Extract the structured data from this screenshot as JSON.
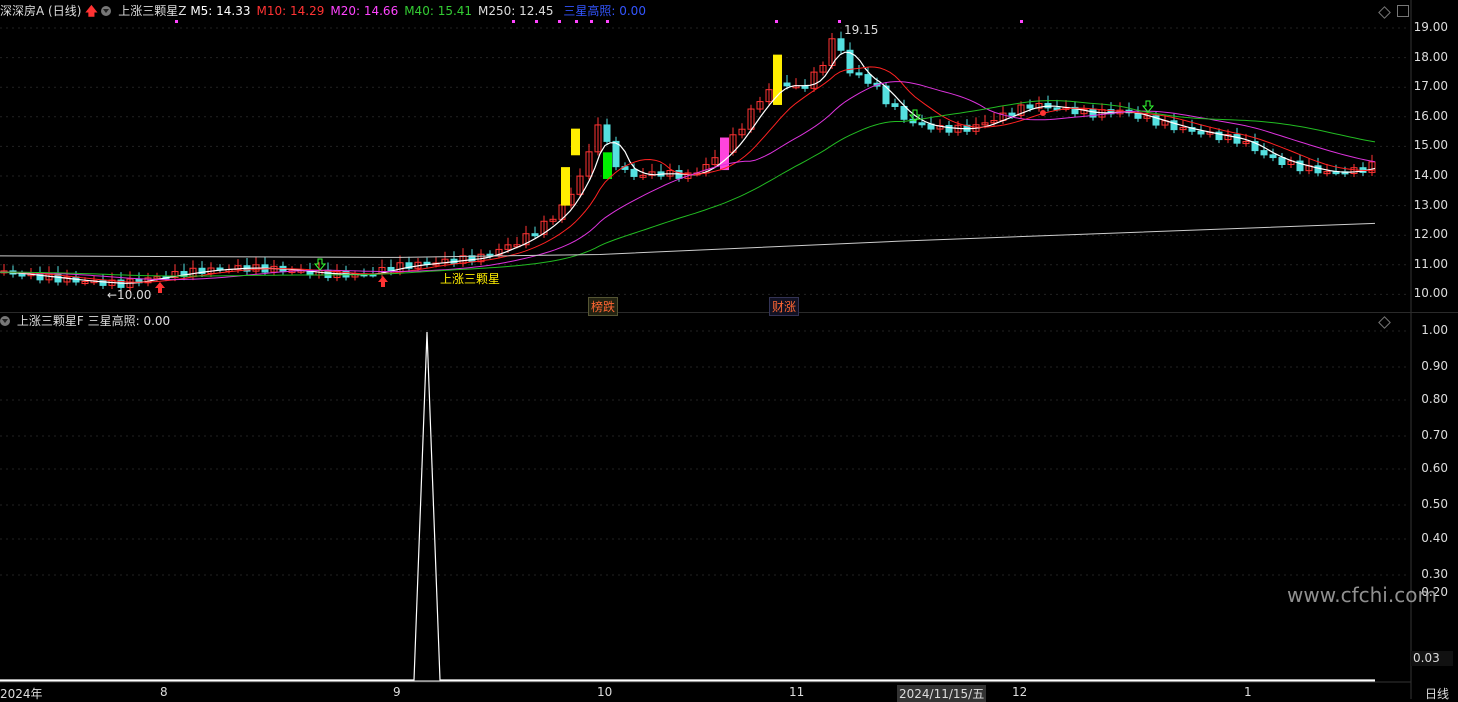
{
  "header_top": {
    "stock_name": "深深房A",
    "period": "(日线)",
    "indicator_name": "上涨三颗星Z",
    "ma": [
      {
        "label": "M5:",
        "value": "14.33",
        "color": "#ffffff"
      },
      {
        "label": "M10:",
        "value": "14.29",
        "color": "#ff3333"
      },
      {
        "label": "M20:",
        "value": "14.66",
        "color": "#ff44ff"
      },
      {
        "label": "M40:",
        "value": "15.41",
        "color": "#33cc33"
      },
      {
        "label": "M250:",
        "value": "12.45",
        "color": "#dddddd"
      }
    ],
    "signal_label": "三星高照:",
    "signal_value": "0.00",
    "signal_color": "#3355ff"
  },
  "header_sub": {
    "indicator_name": "上涨三颗星F",
    "signal_label": "三星高照:",
    "signal_value": "0.00"
  },
  "price_axis": [
    "19.00",
    "18.00",
    "17.00",
    "16.00",
    "15.00",
    "14.00",
    "13.00",
    "12.00",
    "11.00",
    "10.00"
  ],
  "sub_axis": [
    "1.00",
    "0.90",
    "0.80",
    "0.70",
    "0.60",
    "0.50",
    "0.40",
    "0.30",
    "0.20"
  ],
  "sub_current_value": "0.03",
  "x_axis": [
    "2024年",
    "8",
    "9",
    "10",
    "11",
    "2024/11/15/五",
    "12",
    "1",
    "日线"
  ],
  "annotations": {
    "high_label": "19.15",
    "low_label": "←10.00",
    "star_label": "上涨三颗星",
    "tag_1": "榜跌",
    "tag_2": "财涨"
  },
  "watermark": "www.cfchi.com",
  "colors": {
    "up": "#ff3333",
    "down": "#55e0e0",
    "ma5": "#ffffff",
    "ma10": "#ff2222",
    "ma20": "#dd33dd",
    "ma40": "#22bb22",
    "ma250": "#cccccc",
    "yellow_bar": "#ffee00",
    "green_bar": "#00ee00",
    "magenta_bar": "#ff44dd"
  },
  "chart_data": {
    "type": "line",
    "ylim": [
      9.8,
      19.4
    ],
    "close_series_anchor_dates": [
      "2024-07",
      "2024-08",
      "2024-09",
      "2024-10",
      "2024-11",
      "2024-12",
      "2025-01"
    ],
    "ma_latest": {
      "M5": 14.33,
      "M10": 14.29,
      "M20": 14.66,
      "M40": 15.41,
      "M250": 12.45
    },
    "peak": 19.15,
    "trough": 10.0,
    "sub_indicator_ylim": [
      0,
      1.0
    ],
    "sub_indicator_peak": 1.0
  }
}
